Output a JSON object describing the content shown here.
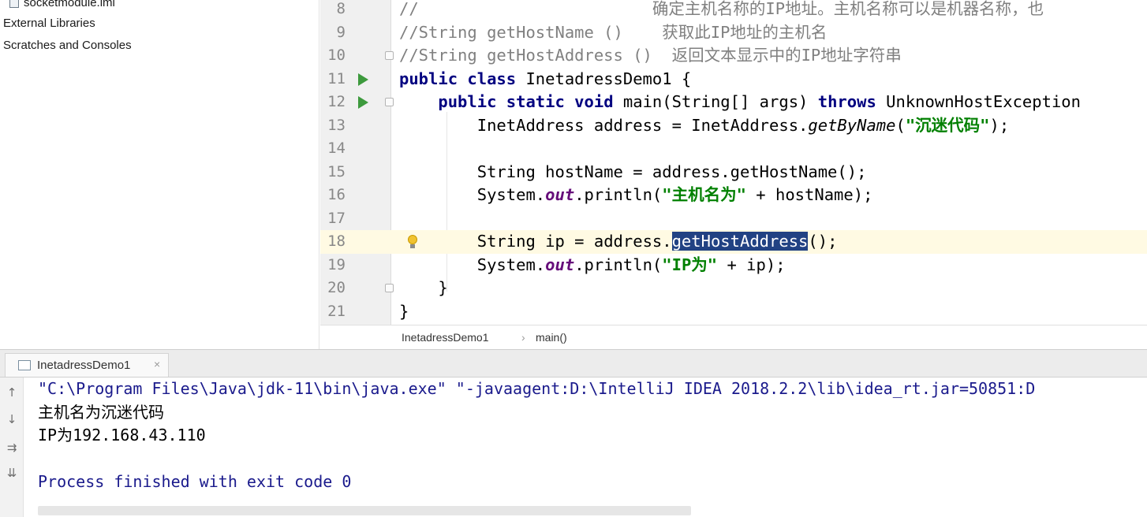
{
  "project_tree": {
    "items": [
      {
        "label": "socketmodule.iml"
      },
      {
        "label": "External Libraries"
      },
      {
        "label": "Scratches and Consoles"
      }
    ]
  },
  "editor": {
    "lines": [
      {
        "num": "8",
        "text": "//                        确定主机名称的IP地址。主机名称可以是机器名称，也"
      },
      {
        "num": "9",
        "text": "//String getHostName ()    获取此IP地址的主机名"
      },
      {
        "num": "10",
        "text": "//String getHostAddress ()  返回文本显示中的IP地址字符串"
      },
      {
        "num": "11",
        "kw1": "public class",
        "rest": " InetadressDemo1 {"
      },
      {
        "num": "12",
        "indent": "    ",
        "kw1": "public static void",
        "mid": " main(String[] args) ",
        "kw2": "throws",
        "rest": " UnknownHostException"
      },
      {
        "num": "13",
        "indent": "        ",
        "pre": "InetAddress address = InetAddress.",
        "method": "getByName",
        "open": "(",
        "str": "\"沉迷代码\"",
        "close": ");"
      },
      {
        "num": "14"
      },
      {
        "num": "15",
        "text": "        String hostName = address.getHostName();"
      },
      {
        "num": "16",
        "indent": "        ",
        "pre": "System.",
        "field": "out",
        "mid": ".println(",
        "str": "\"主机名为\"",
        "close": " + hostName);"
      },
      {
        "num": "17"
      },
      {
        "num": "18",
        "indent": "        ",
        "pre": "String ip = address.",
        "selected": "getHostAddress",
        "close": "();"
      },
      {
        "num": "19",
        "indent": "        ",
        "pre": "System.",
        "field": "out",
        "mid": ".println(",
        "str": "\"IP为\"",
        "close": " + ip);"
      },
      {
        "num": "20",
        "text": "    }"
      },
      {
        "num": "21",
        "text": "}"
      }
    ],
    "breadcrumb": {
      "class_name": "InetadressDemo1",
      "separator": "›",
      "method_name": "main()"
    }
  },
  "run_panel": {
    "tab_label": "InetadressDemo1",
    "tab_close": "×",
    "toolbar": [
      {
        "name": "scroll-up-icon",
        "glyph": "↑"
      },
      {
        "name": "scroll-down-icon",
        "glyph": "↓"
      },
      {
        "name": "soft-wrap-icon",
        "glyph": "⇉"
      },
      {
        "name": "scroll-to-end-icon",
        "glyph": "⇊"
      }
    ],
    "console_lines": [
      "\"C:\\Program Files\\Java\\jdk-11\\bin\\java.exe\" \"-javaagent:D:\\IntelliJ IDEA 2018.2.2\\lib\\idea_rt.jar=50851:D",
      "主机名为沉迷代码",
      "IP为192.168.43.110",
      "",
      "Process finished with exit code 0"
    ]
  },
  "colors": {
    "keyword": "#000080",
    "comment": "#808080",
    "string": "#008000",
    "selection": "#214283",
    "caret_row": "#fffae3",
    "run_icon": "#3d9a3d"
  }
}
